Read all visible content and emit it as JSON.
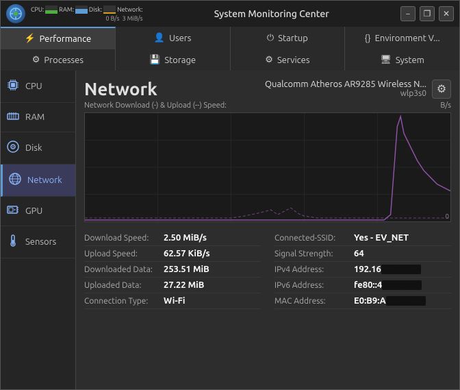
{
  "window": {
    "title": "System Monitoring Center",
    "minimize_label": "−",
    "restore_label": "❐",
    "close_label": "✕"
  },
  "titlebar": {
    "cpu_label": "CPU:",
    "ram_label": "RAM:",
    "disk_label": "Disk:",
    "network_label": "Network:",
    "net_speed": "0 B/s",
    "net_speed2": "3 MiB/s"
  },
  "nav_tabs": [
    {
      "id": "performance",
      "label": "Performance",
      "icon": "⚡",
      "active": true
    },
    {
      "id": "users",
      "label": "Users",
      "icon": "👤"
    },
    {
      "id": "startup",
      "label": "Startup",
      "icon": "⏻"
    },
    {
      "id": "environment",
      "label": "Environment V...",
      "icon": "{}"
    }
  ],
  "nav_tabs2": [
    {
      "id": "processes",
      "label": "Processes",
      "icon": "⚙"
    },
    {
      "id": "storage",
      "label": "Storage",
      "icon": "💾"
    },
    {
      "id": "services",
      "label": "Services",
      "icon": "⚙"
    },
    {
      "id": "system",
      "label": "System",
      "icon": "🖥"
    }
  ],
  "sidebar": {
    "items": [
      {
        "id": "cpu",
        "label": "CPU",
        "icon": "🔲"
      },
      {
        "id": "ram",
        "label": "RAM",
        "icon": "🔲"
      },
      {
        "id": "disk",
        "label": "Disk",
        "icon": "💿"
      },
      {
        "id": "network",
        "label": "Network",
        "icon": "🌐",
        "active": true
      },
      {
        "id": "gpu",
        "label": "GPU",
        "icon": "🎮"
      },
      {
        "id": "sensors",
        "label": "Sensors",
        "icon": "🌡"
      }
    ]
  },
  "main": {
    "title": "Network",
    "device_name": "Qualcomm Atheros AR9285 Wireless N...",
    "device_iface": "wlp3s0",
    "chart_label": "Network Download (-) & Upload (--) Speed:",
    "chart_unit": "B/s",
    "chart_zero": "0",
    "stats": {
      "left": [
        {
          "label": "Download Speed:",
          "value": "2.50 MiB/s"
        },
        {
          "label": "Upload Speed:",
          "value": "62.57 KiB/s"
        },
        {
          "label": "Downloaded Data:",
          "value": "253.51 MiB"
        },
        {
          "label": "Uploaded Data:",
          "value": "27.22 MiB"
        },
        {
          "label": "Connection Type:",
          "value": "Wi-Fi"
        }
      ],
      "right": [
        {
          "label": "Connected-SSID:",
          "value": "Yes - EV_NET"
        },
        {
          "label": "Signal Strength:",
          "value": "64"
        },
        {
          "label": "IPv4 Address:",
          "value": "192.16",
          "redacted": true
        },
        {
          "label": "IPv6 Address:",
          "value": "fe80::4",
          "redacted": true
        },
        {
          "label": "MAC Address:",
          "value": "E0:B9:A",
          "redacted": true
        }
      ]
    }
  }
}
